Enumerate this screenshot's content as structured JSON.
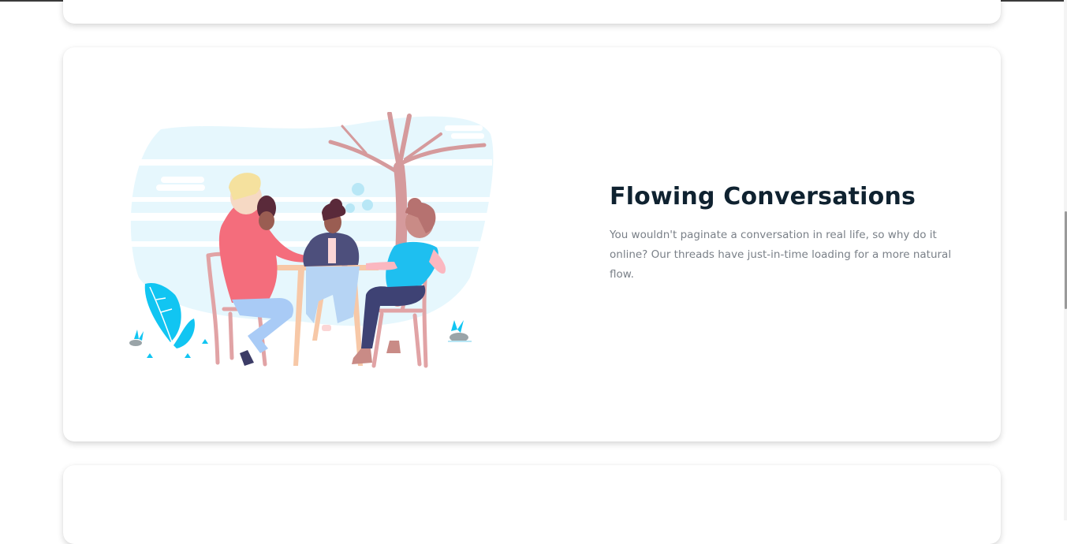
{
  "feature": {
    "title": "Flowing Conversations",
    "description": "You wouldn't paginate a conversation in real life, so why do it online? Our threads have just-in-time loading for a more natural flow."
  },
  "illustration": {
    "subject": "friends-conversation-at-table-illustration"
  },
  "colors": {
    "title": "#0f2230",
    "description": "#7a8088",
    "card_background": "#ffffff",
    "sky": "#e6f7fd",
    "plant_accent": "#11c5f2",
    "chair": "#e1a3a5"
  }
}
